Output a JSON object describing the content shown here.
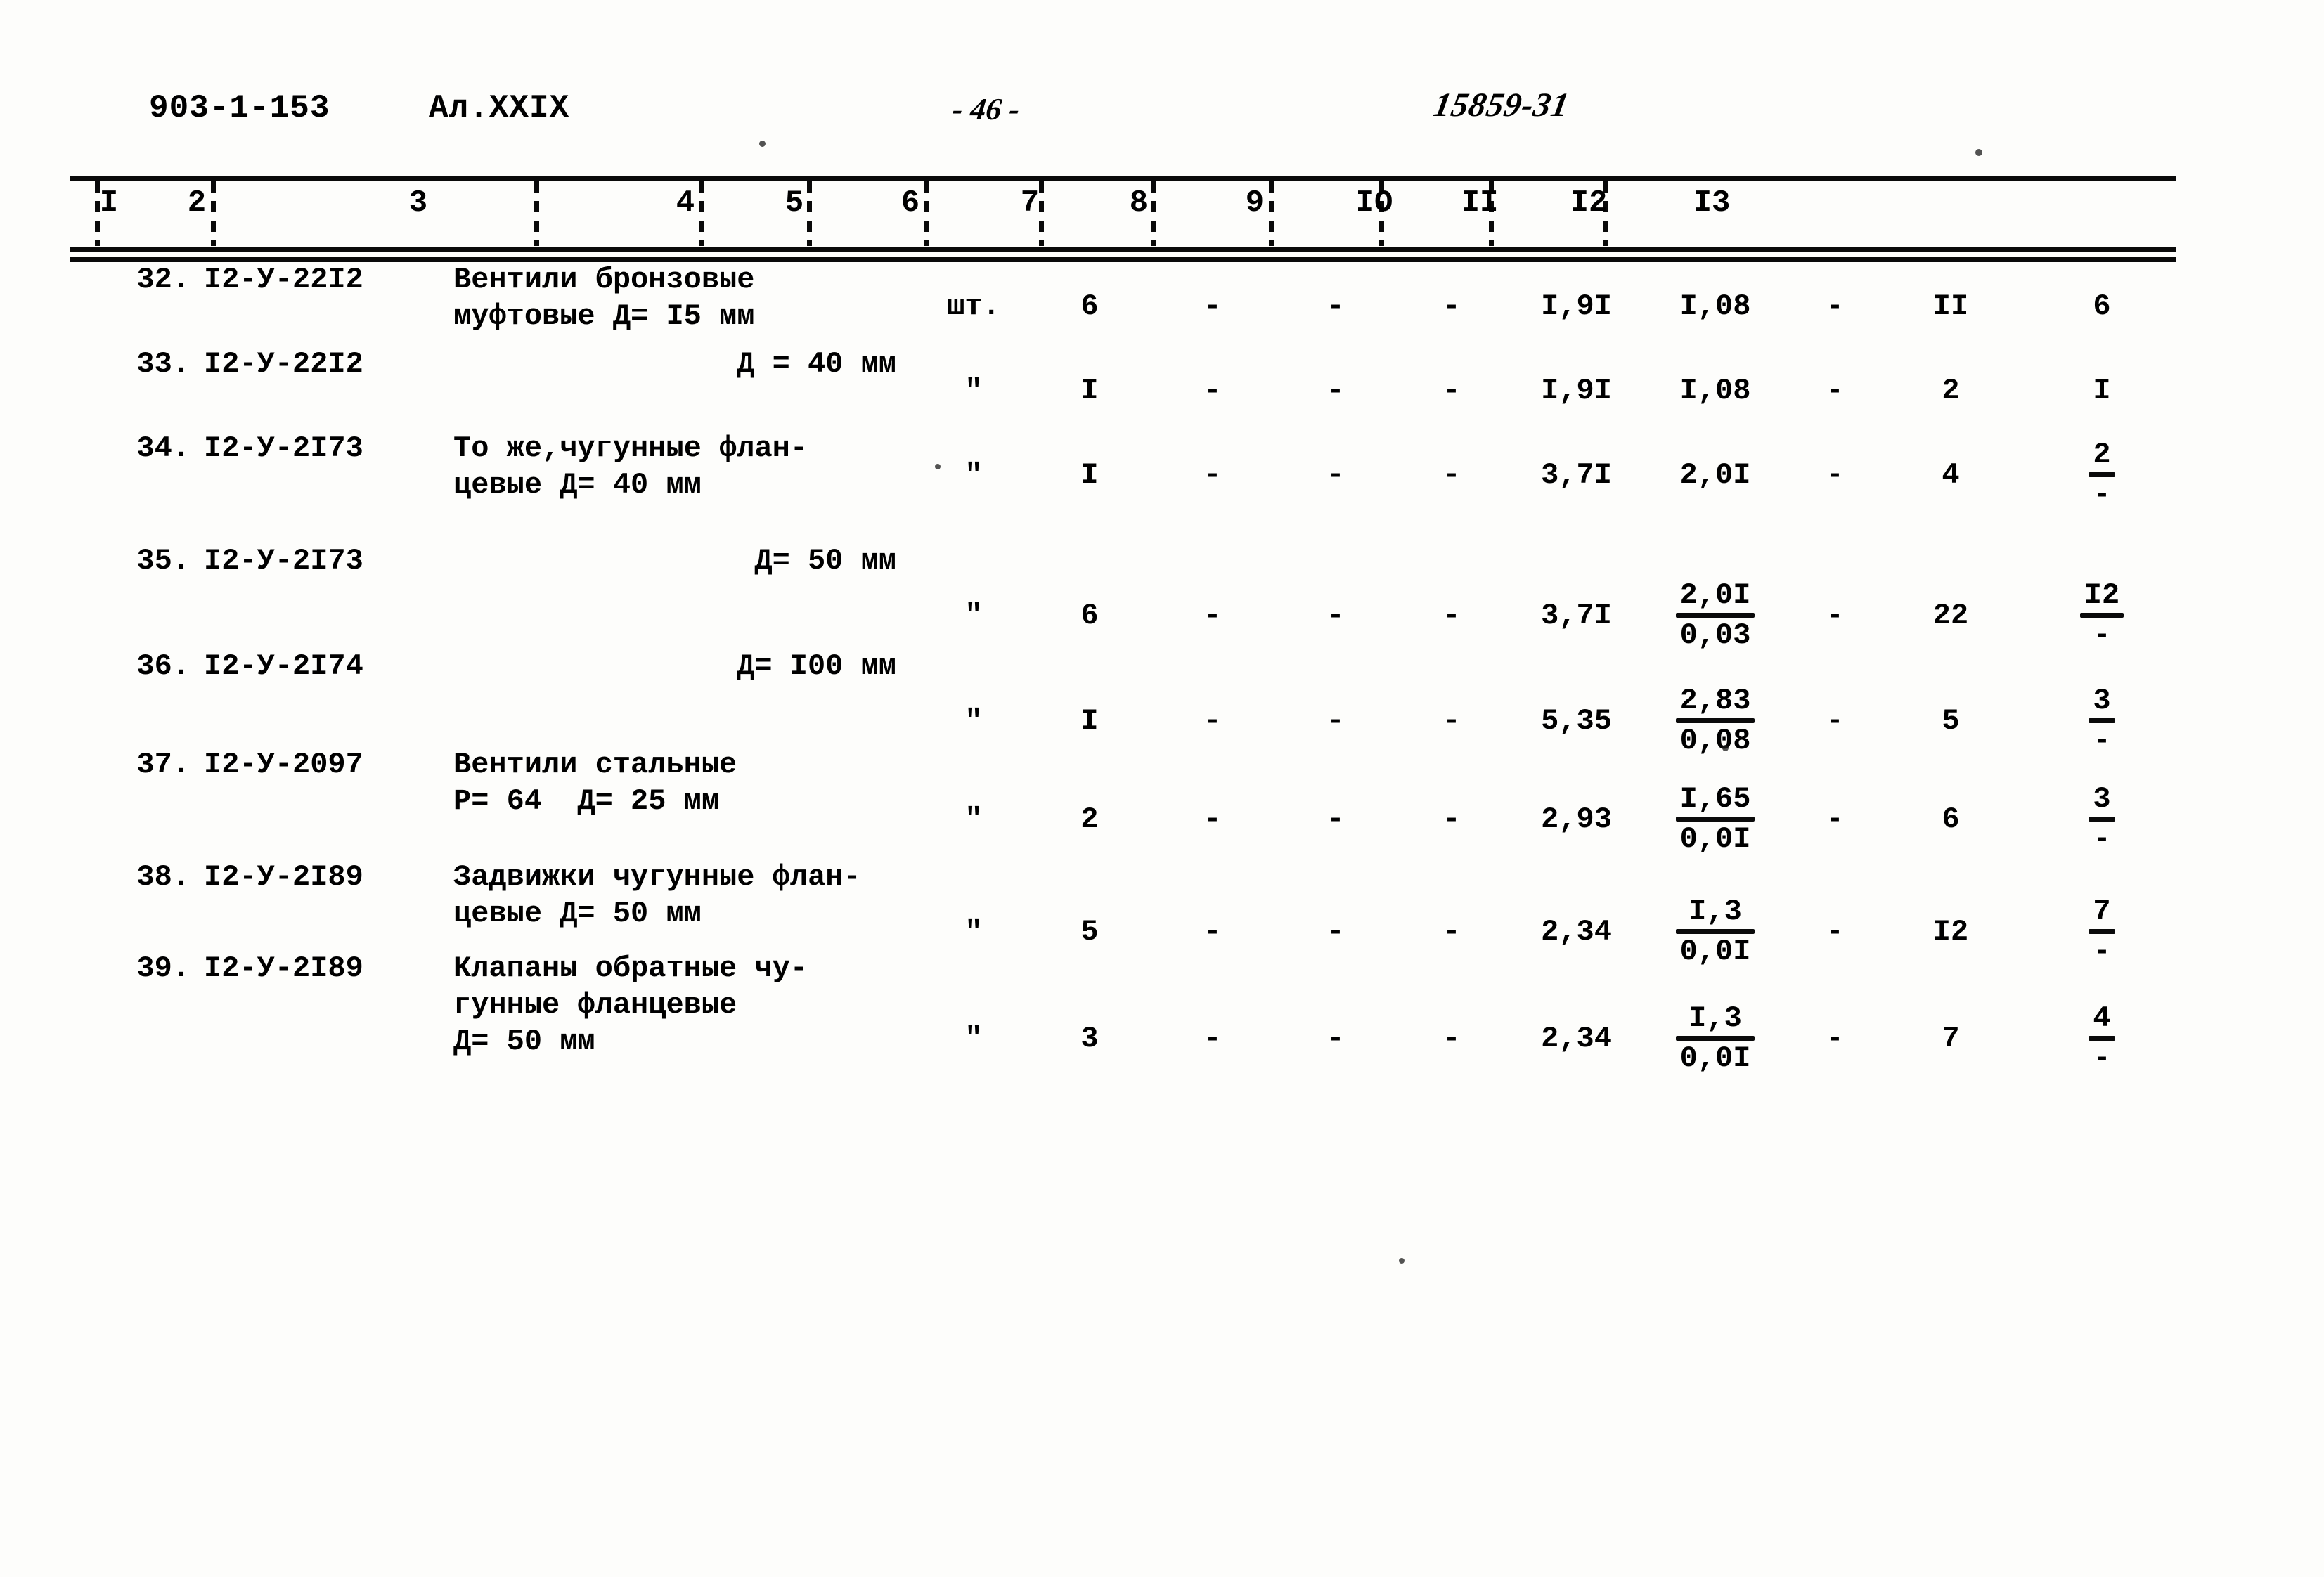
{
  "header": {
    "document_code": "903-1-153",
    "album": "Ал.XXIX",
    "page_marker": "- 46 -",
    "stamp": "15859-31"
  },
  "table": {
    "column_headers": [
      "I",
      "2",
      "3",
      "4",
      "5",
      "6",
      "7",
      "8",
      "9",
      "IO",
      "II",
      "I2",
      "I3"
    ],
    "rows": [
      {
        "num": "32.",
        "code": "I2-У-22I2",
        "name_line1": "Вентили бронзовые",
        "name_line2": "муфтовые Д= I5 мм",
        "name_align": "left",
        "unit": "шт.",
        "c5": "6",
        "c6": "-",
        "c7": "-",
        "c8": "-",
        "c9": "I,9I",
        "c10": "I,08",
        "c10_denom": "",
        "c11": "-",
        "c12": "II",
        "c13": "6",
        "c13_denom": ""
      },
      {
        "num": "33.",
        "code": "I2-У-22I2",
        "name_line1": "Д = 40 мм",
        "name_line2": "",
        "name_align": "right",
        "unit": "\"",
        "c5": "I",
        "c6": "-",
        "c7": "-",
        "c8": "-",
        "c9": "I,9I",
        "c10": "I,08",
        "c10_denom": "",
        "c11": "-",
        "c12": "2",
        "c13": "I",
        "c13_denom": ""
      },
      {
        "num": "34.",
        "code": "I2-У-2I73",
        "name_line1": "То же,чугунные флан-",
        "name_line2": "цевые Д= 40 мм",
        "name_align": "left",
        "unit": "\"",
        "c5": "I",
        "c6": "-",
        "c7": "-",
        "c8": "-",
        "c9": "3,7I",
        "c10": "2,0I",
        "c10_denom": "",
        "c11": "-",
        "c12": "4",
        "c13": "2",
        "c13_denom": "-"
      },
      {
        "num": "35.",
        "code": "I2-У-2I73",
        "name_line1": "Д= 50 мм",
        "name_line2": "",
        "name_align": "right",
        "unit": "\"",
        "c5": "6",
        "c6": "-",
        "c7": "-",
        "c8": "-",
        "c9": "3,7I",
        "c10": "2,0I",
        "c10_denom": "0,03",
        "c11": "-",
        "c12": "22",
        "c13": "I2",
        "c13_denom": "-"
      },
      {
        "num": "36.",
        "code": "I2-У-2I74",
        "name_line1": "Д= I00 мм",
        "name_line2": "",
        "name_align": "right",
        "unit": "\"",
        "c5": "I",
        "c6": "-",
        "c7": "-",
        "c8": "-",
        "c9": "5,35",
        "c10": "2,83",
        "c10_denom": "0,08",
        "c11": "-",
        "c12": "5",
        "c13": "3",
        "c13_denom": "-"
      },
      {
        "num": "37.",
        "code": "I2-У-2097",
        "name_line1": "Вентили стальные",
        "name_line2": "Р= 64  Д= 25 мм",
        "name_align": "left",
        "unit": "\"",
        "c5": "2",
        "c6": "-",
        "c7": "-",
        "c8": "-",
        "c9": "2,93",
        "c10": "I,65",
        "c10_denom": "0,0I",
        "c11": "-",
        "c12": "6",
        "c13": "3",
        "c13_denom": "-"
      },
      {
        "num": "38.",
        "code": "I2-У-2I89",
        "name_line1": "Задвижки чугунные флан-",
        "name_line2": "цевые Д= 50 мм",
        "name_align": "left",
        "unit": "\"",
        "c5": "5",
        "c6": "-",
        "c7": "-",
        "c8": "-",
        "c9": "2,34",
        "c10": "I,3",
        "c10_denom": "0,0I",
        "c11": "-",
        "c12": "I2",
        "c13": "7",
        "c13_denom": "-"
      },
      {
        "num": "39.",
        "code": "I2-У-2I89",
        "name_line1": "Клапаны обратные чу-",
        "name_line2": "гунные фланцевые",
        "name_line3": "Д= 50 мм",
        "name_align": "left",
        "unit": "\"",
        "c5": "3",
        "c6": "-",
        "c7": "-",
        "c8": "-",
        "c9": "2,34",
        "c10": "I,3",
        "c10_denom": "0,0I",
        "c11": "-",
        "c12": "7",
        "c13": "4",
        "c13_denom": "-"
      }
    ]
  }
}
